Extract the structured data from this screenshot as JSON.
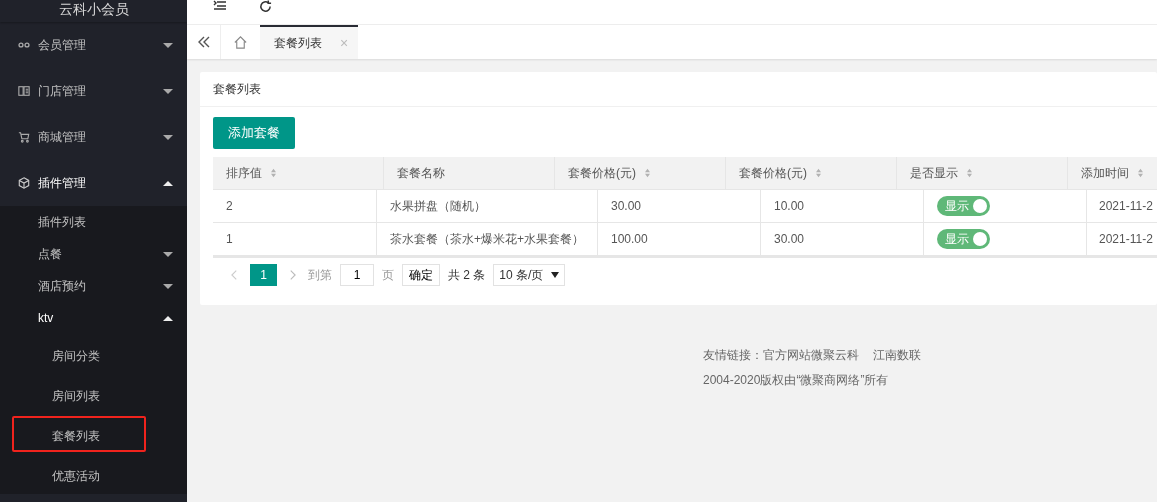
{
  "sidebar": {
    "title": "云科小会员",
    "items": [
      {
        "label": "会员管理",
        "kind": "group",
        "expanded": false
      },
      {
        "label": "门店管理",
        "kind": "group",
        "expanded": false
      },
      {
        "label": "商城管理",
        "kind": "group",
        "expanded": false
      },
      {
        "label": "插件管理",
        "kind": "group",
        "expanded": true,
        "children": [
          {
            "label": "插件列表",
            "kind": "link"
          },
          {
            "label": "点餐",
            "kind": "group",
            "expanded": false
          },
          {
            "label": "酒店预约",
            "kind": "group",
            "expanded": false
          },
          {
            "label": "ktv",
            "kind": "group",
            "expanded": true,
            "children": [
              {
                "label": "房间分类",
                "highlighted": false
              },
              {
                "label": "房间列表",
                "highlighted": false
              },
              {
                "label": "套餐列表",
                "highlighted": true
              },
              {
                "label": "优惠活动",
                "highlighted": false
              }
            ]
          }
        ]
      }
    ]
  },
  "tabs": [
    {
      "kind": "home",
      "selected": false
    },
    {
      "kind": "page",
      "label": "套餐列表",
      "close": "×",
      "selected": true
    }
  ],
  "card": {
    "title": "套餐列表",
    "add_button": "添加套餐",
    "table": {
      "columns": [
        {
          "label": "排序值",
          "sortable": true
        },
        {
          "label": "套餐名称",
          "sortable": false
        },
        {
          "label": "套餐价格(元)",
          "sortable": true
        },
        {
          "label": "套餐价格(元)",
          "sortable": true
        },
        {
          "label": "是否显示",
          "sortable": true
        },
        {
          "label": "添加时间",
          "sortable": true
        }
      ],
      "rows": [
        {
          "sort": "2",
          "name": "水果拼盘（随机）",
          "price_1": "30.00",
          "price_2": "10.00",
          "visible": {
            "on": true,
            "label": "显示"
          },
          "added": "2021-11-2"
        },
        {
          "sort": "1",
          "name": "茶水套餐（茶水+爆米花+水果套餐）",
          "price_1": "100.00",
          "price_2": "30.00",
          "visible": {
            "on": true,
            "label": "显示"
          },
          "added": "2021-11-2"
        }
      ]
    },
    "pagination": {
      "pages": [
        {
          "label": "1",
          "selected": true
        }
      ],
      "goto_label": "到第",
      "goto_value": "1",
      "page_unit": "页",
      "confirm": "确定",
      "total": "共 2 条",
      "page_size": "10 条/页"
    }
  },
  "footer": {
    "links_label": "友情链接：",
    "links": [
      "官方网站微聚云科",
      "江南数联"
    ],
    "copyright": "2004-2020版权由“微聚商网络”所有"
  }
}
